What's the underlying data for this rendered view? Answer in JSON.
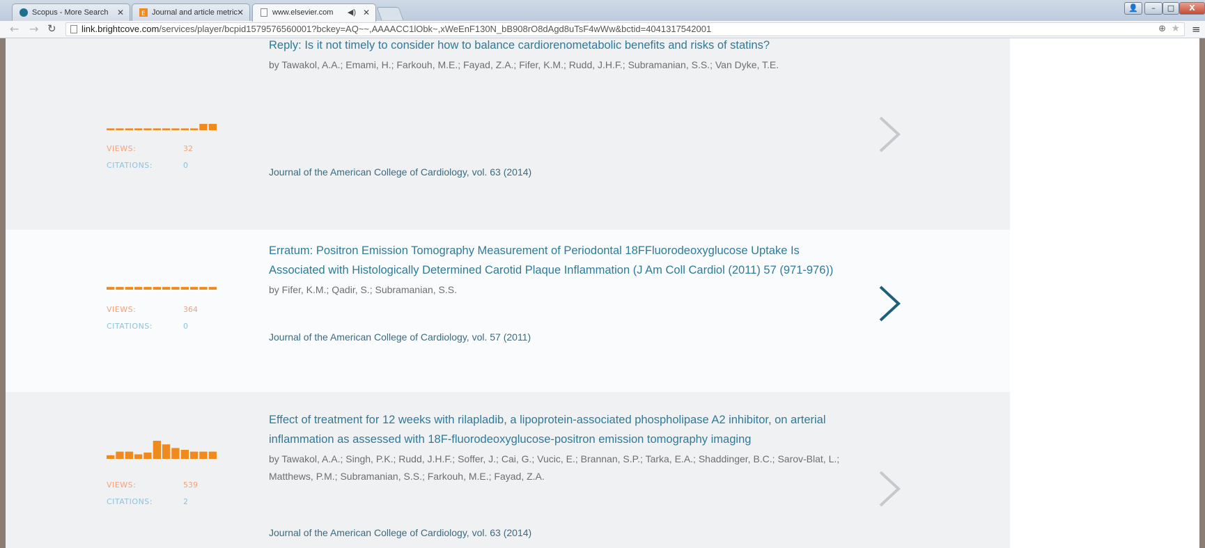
{
  "browser": {
    "tabs": [
      {
        "label": "Scopus - More Search",
        "active": false
      },
      {
        "label": "Journal and article metric",
        "active": false
      },
      {
        "label": "www.elsevier.com",
        "active": true
      }
    ],
    "window_controls": {
      "minimize": "–",
      "maximize": "□",
      "close": "X"
    },
    "url_host": "link.brightcove.com",
    "url_path": "/services/player/bcpid1579576560001?bckey=AQ~~,AAAACC1lObk~,xWeEnF130N_bB908rO8dAgd8uTsF4wWw&bctid=4041317542001",
    "icons": {
      "back": "back-arrow-icon",
      "forward": "forward-arrow-icon",
      "reload": "reload-icon",
      "zoom": "zoom-icon",
      "star": "star-icon",
      "menu": "hamburger-menu-icon"
    }
  },
  "colors": {
    "accent": "#2f7a99",
    "views": "#f2a27a",
    "citations": "#8ec2dc",
    "bar": "#f08a1c"
  },
  "articles": [
    {
      "title": "Reply: Is it not timely to consider how to balance cardiorenometabolic benefits and risks of statins?",
      "authors": "by Tawakol, A.A.; Emami, H.; Farkouh, M.E.; Fayad, Z.A.; Fifer, K.M.; Rudd, J.H.F.; Subramanian, S.S.; Van Dyke, T.E.",
      "journal": "Journal of the American College of Cardiology, vol. 63 (2014)",
      "views_label": "VIEWS:",
      "views": "32",
      "citations_label": "CITATIONS:",
      "citations": "0",
      "trend": [
        0.1,
        0.1,
        0.1,
        0.1,
        0.1,
        0.1,
        0.1,
        0.1,
        0.1,
        0.1,
        0.35,
        0.35
      ],
      "chevron_active": false
    },
    {
      "title": "Erratum: Positron Emission Tomography Measurement of Periodontal 18FFluorodeoxyglucose Uptake Is Associated with Histologically Determined Carotid Plaque Inflammation (J Am Coll Cardiol (2011) 57 (971-976))",
      "authors": "by Fifer, K.M.; Qadir, S.; Subramanian, S.S.",
      "journal": "Journal of the American College of Cardiology, vol. 57 (2011)",
      "views_label": "VIEWS:",
      "views": "364",
      "citations_label": "CITATIONS:",
      "citations": "0",
      "trend": [
        0.15,
        0.15,
        0.15,
        0.15,
        0.15,
        0.15,
        0.15,
        0.15,
        0.15,
        0.15,
        0.15,
        0.15
      ],
      "chevron_active": true
    },
    {
      "title": "Effect of treatment for 12 weeks with rilapladib, a lipoprotein-associated phospholipase A2 inhibitor, on arterial inflammation as assessed with 18F-fluorodeoxyglucose-positron emission tomography imaging",
      "authors": "by Tawakol, A.A.; Singh, P.K.; Rudd, J.H.F.; Soffer, J.; Cai, G.; Vucic, E.; Brannan, S.P.; Tarka, E.A.; Shaddinger, B.C.; Sarov-Blat, L.; Matthews, P.M.; Subramanian, S.S.; Farkouh, M.E.; Fayad, Z.A.",
      "journal": "Journal of the American College of Cardiology, vol. 63 (2014)",
      "views_label": "VIEWS:",
      "views": "539",
      "citations_label": "CITATIONS:",
      "citations": "2",
      "trend": [
        0.2,
        0.4,
        0.4,
        0.25,
        0.35,
        1.0,
        0.8,
        0.6,
        0.5,
        0.4,
        0.4,
        0.4
      ],
      "chevron_active": false
    }
  ]
}
